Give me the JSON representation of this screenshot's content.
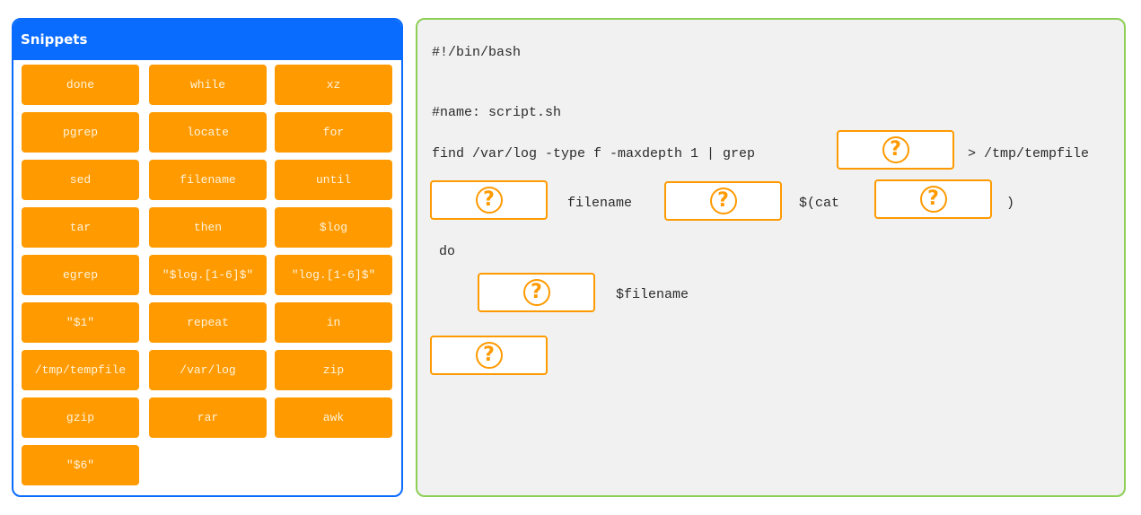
{
  "snippets": {
    "title": "Snippets",
    "items": [
      "done",
      "while",
      "xz",
      "pgrep",
      "locate",
      "for",
      "sed",
      "filename",
      "until",
      "tar",
      "then",
      "$log",
      "egrep",
      "\"$log.[1-6]$\"",
      "\"log.[1-6]$\"",
      "\"$1\"",
      "repeat",
      "in",
      "/tmp/tempfile",
      "/var/log",
      "zip",
      "gzip",
      "rar",
      "awk",
      "\"$6\""
    ]
  },
  "code": {
    "shebang": "#!/bin/bash",
    "name_comment": "#name: script.sh",
    "find_line_prefix": "find /var/log -type f -maxdepth 1 | grep",
    "find_line_suffix": "> /tmp/tempfile",
    "loop_var": "filename",
    "cat_open": "$(cat",
    "cat_close": ")",
    "do_keyword": "do",
    "body_arg": "$filename",
    "drop_zone_icon": "?"
  },
  "colors": {
    "snippets_border": "#0a6bff",
    "snippet_fill": "#ff9a00",
    "code_border": "#8dcf55",
    "drop_zone_border": "#ff9a00"
  }
}
